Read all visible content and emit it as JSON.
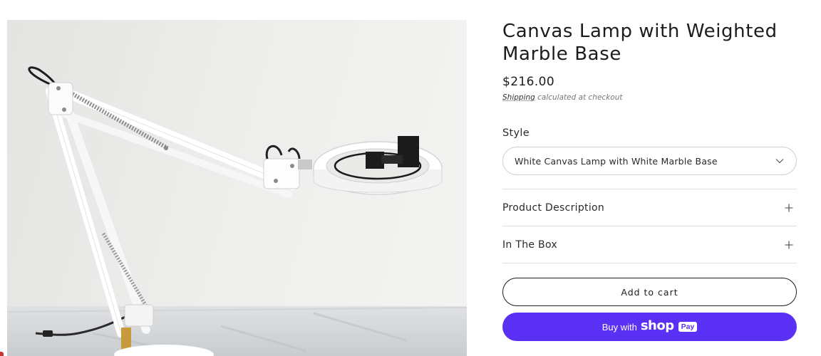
{
  "product": {
    "title": "Canvas Lamp with Weighted Marble Base",
    "price": "$216.00",
    "shipping_link": "Shipping",
    "shipping_note": "calculated at checkout",
    "image_icon": "desk-lamp-photo"
  },
  "options": {
    "style_label": "Style",
    "style_value": "White Canvas Lamp with White Marble Base"
  },
  "accordion": [
    {
      "label": "Product Description"
    },
    {
      "label": "In The Box"
    }
  ],
  "buttons": {
    "add_to_cart": "Add to cart",
    "buy_with": "Buy with",
    "shop_word": "shop",
    "pay_badge": "Pay"
  },
  "colors": {
    "shop_pay": "#5a31f4",
    "text": "#1c1c1c",
    "border": "#dedede"
  }
}
